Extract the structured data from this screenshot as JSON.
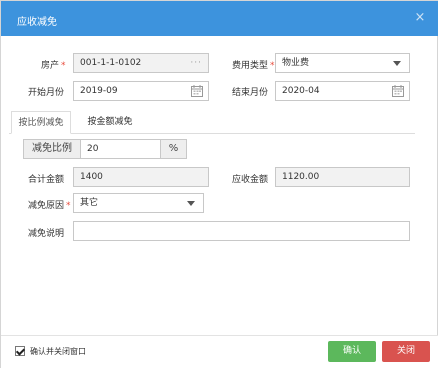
{
  "dialog": {
    "title": "应收减免",
    "close_glyph": "×"
  },
  "form": {
    "property_label": "房产",
    "property_value": "001-1-1-0102",
    "property_more": "···",
    "fee_type_label": "费用类型",
    "fee_type_value": "物业费",
    "start_month_label": "开始月份",
    "start_month_value": "2019-09",
    "end_month_label": "结束月份",
    "end_month_value": "2020-04",
    "required_mark": "*"
  },
  "tabs": [
    {
      "label": "按比例减免",
      "active": true
    },
    {
      "label": "按金额减免",
      "active": false
    }
  ],
  "ratio": {
    "label": "减免比例",
    "value": "20",
    "unit": "%"
  },
  "amounts": {
    "total_label": "合计金额",
    "total_value": "1400",
    "receivable_label": "应收金额",
    "receivable_value": "1120.00"
  },
  "reason": {
    "label": "减免原因",
    "value": "其它"
  },
  "note": {
    "label": "减免说明",
    "value": ""
  },
  "footer": {
    "confirm_close_label": "确认并关闭窗口",
    "confirm_close_checked": true,
    "ok_label": "确认",
    "cancel_label": "关闭"
  },
  "colors": {
    "titlebar": "#3d93dd",
    "ok_button": "#5cb85c",
    "cancel_button": "#d9534f",
    "required": "#e84c3d"
  }
}
